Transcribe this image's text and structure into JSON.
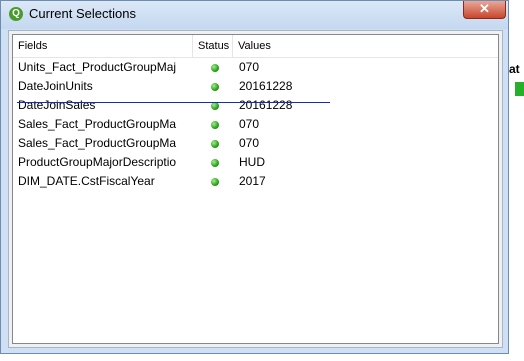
{
  "window": {
    "title": "Current Selections",
    "app_icon_letter": "Q",
    "close_glyph": "✕"
  },
  "columns": {
    "fields": "Fields",
    "status": "Status",
    "values": "Values"
  },
  "rows": [
    {
      "field": "Units_Fact_ProductGroupMaj",
      "status": "selected",
      "value": "070"
    },
    {
      "field": "DateJoinUnits",
      "status": "selected",
      "value": "20161228"
    },
    {
      "field": "DateJoinSales",
      "status": "selected",
      "value": "20161228"
    },
    {
      "field": "Sales_Fact_ProductGroupMa",
      "status": "selected",
      "value": "070"
    },
    {
      "field": "Sales_Fact_ProductGroupMa",
      "status": "selected",
      "value": "070"
    },
    {
      "field": "ProductGroupMajorDescriptio",
      "status": "selected",
      "value": "HUD"
    },
    {
      "field": "DIM_DATE.CstFiscalYear",
      "status": "selected",
      "value": "2017"
    }
  ],
  "background": {
    "partial_text": "at"
  },
  "colors": {
    "status_selected": "#2aa11a",
    "annotation_line": "#1a2bb0"
  }
}
